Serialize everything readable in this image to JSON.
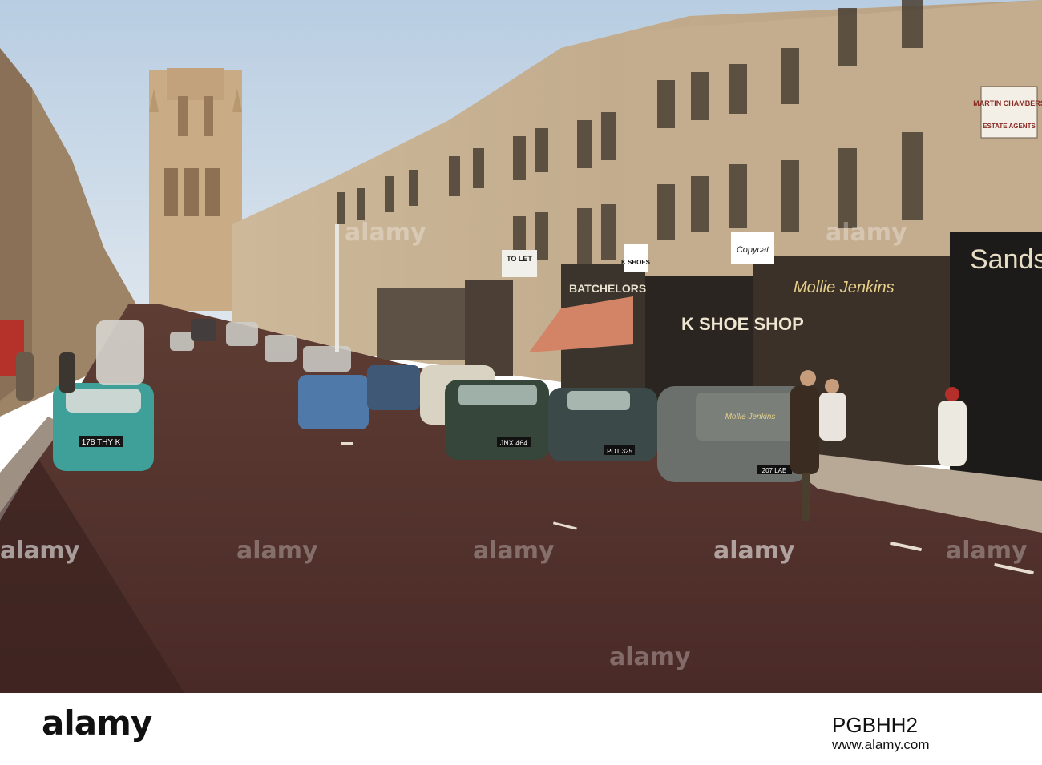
{
  "photo": {
    "shop_signs": {
      "martin_chambers": "MARTIN CHAMBERS",
      "estate_agents": "ESTATE AGENTS",
      "sands": "Sands",
      "mollie_jenkins": "Mollie Jenkins",
      "shoe_shop": "K SHOE SHOP",
      "k_shoes": "K SHOES",
      "copycat": "Copycat",
      "to_let": "TO LET",
      "batchelors": "BATCHELORS"
    },
    "plates": {
      "teal_car": "178 THY K",
      "green_car": "JNX 464",
      "dark_car": "POT 325",
      "van": "207 LAE"
    }
  },
  "watermarks": [
    "alamy",
    "alamy",
    "alamy",
    "alamy",
    "alamy",
    "alamy",
    "alamy",
    "alamy"
  ],
  "footer": {
    "logo": "alamy",
    "image_id": "PGBHH2",
    "url": "www.alamy.com"
  }
}
